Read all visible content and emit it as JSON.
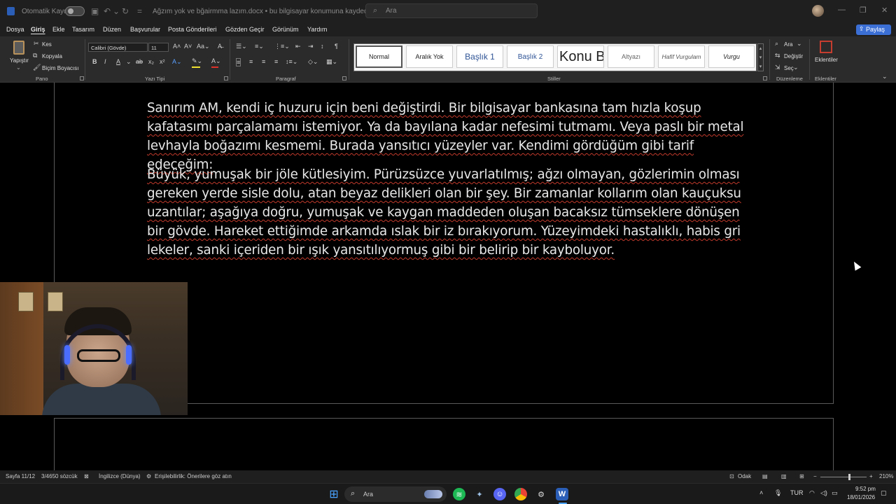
{
  "titlebar": {
    "autosave_label": "Otomatik Kaydet",
    "doc_name": "Ağzım yok ve bğairmma lazım.docx • bu bilgisayar konumuna kaydedildi ⌄",
    "search_placeholder": "Ara"
  },
  "menu": {
    "items": [
      "Dosya",
      "Giriş",
      "Ekle",
      "Tasarım",
      "Düzen",
      "Başvurular",
      "Posta Gönderileri",
      "Gözden Geçir",
      "Görünüm",
      "Yardım"
    ],
    "share_label": "Paylaş"
  },
  "ribbon": {
    "paste_label": "Yapıştır",
    "cut_label": "Kes",
    "copy_label": "Kopyala",
    "format_painter_label": "Biçim Boyacısı",
    "clipboard_group": "Pano",
    "font_name": "Calibri (Gövde)",
    "font_size": "11",
    "font_group": "Yazı Tipi",
    "paragraph_group": "Paragraf",
    "styles_group": "Stiller",
    "styles": [
      "Normal",
      "Aralık Yok",
      "Başlık 1",
      "Başlık 2",
      "Konu B",
      "Altyazı",
      "Hafif Vurgulam",
      "Vurgu"
    ],
    "find_label": "Ara",
    "replace_label": "Değiştir",
    "select_label": "Seç",
    "editing_group": "Düzenleme",
    "addins_label": "Eklentiler",
    "addins_group": "Eklentiler"
  },
  "document": {
    "paragraph_1": "Sanırım AM, kendi iç huzuru için beni değiştirdi. Bir bilgisayar bankasına tam hızla koşup kafatasımı parçalamamı istemiyor. Ya da bayılana kadar nefesimi tutmamı. Veya paslı bir metal levhayla boğazımı kesmemi. Burada yansıtıcı yüzeyler var. Kendimi gördüğüm gibi tarif edeceğim:",
    "paragraph_2": "Büyük, yumuşak bir jöle kütlesiyim. Pürüzsüzce yuvarlatılmış; ağzı olmayan, gözlerimin olması gereken yerde sisle dolu, atan beyaz delikleri olan bir şey. Bir zamanlar kollarım olan kauçuksu uzantılar; aşağıya doğru, yumuşak ve kaygan maddeden oluşan bacaksız tümseklere dönüşen bir gövde. Hareket ettiğimde arkamda ıslak bir iz bırakıyorum. Yüzeyimdeki hastalıklı, habis gri lekeler, sanki içeriden bir ışık yansıtılıyormuş gibi bir belirip bir kayboluyor."
  },
  "status": {
    "page": "Sayfa 11/12",
    "words": "3/4650 sözcük",
    "language": "İngilizce (Dünya)",
    "accessibility": "Erişilebilirlik: Önerilere göz atın",
    "focus": "Odak",
    "zoom": "210%"
  },
  "taskbar": {
    "search_label": "Ara",
    "lang": "TUR",
    "time": "9:52 pm",
    "date": "18/01/2026"
  },
  "colors": {
    "accent": "#3b6fd6",
    "spellcheck": "#c0392b"
  }
}
